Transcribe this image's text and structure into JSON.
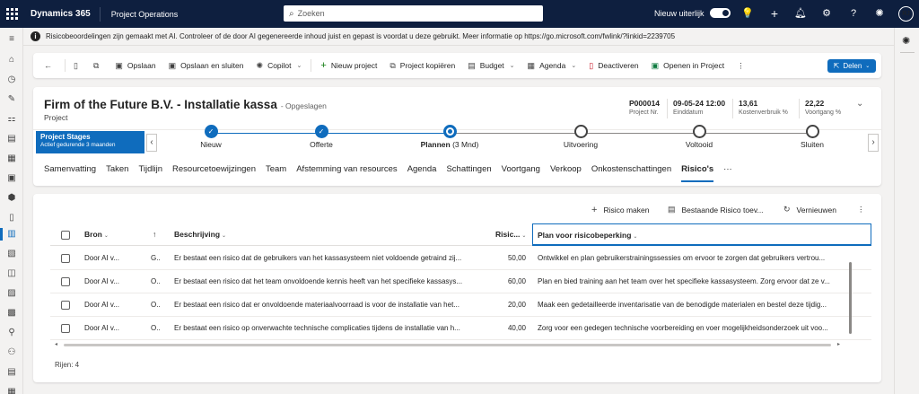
{
  "topbar": {
    "brand": "Dynamics 365",
    "app": "Project Operations",
    "search_placeholder": "Zoeken",
    "new_look": "Nieuw uiterlijk",
    "avatar_initials": "RJ"
  },
  "banner": {
    "text": "Risicobeoordelingen zijn gemaakt met AI. Controleer of de door AI gegenereerde inhoud juist en gepast is voordat u deze gebruikt. Meer informatie op https://go.microsoft.com/fwlink/?linkid=2239705"
  },
  "commandbar": {
    "save": "Opslaan",
    "save_close": "Opslaan en sluiten",
    "copilot": "Copilot",
    "new_project": "Nieuw project",
    "copy_project": "Project kopiëren",
    "budget": "Budget",
    "agenda": "Agenda",
    "deactivate": "Deactiveren",
    "open_in_project": "Openen in Project",
    "share": "Delen"
  },
  "record": {
    "title": "Firm of the Future B.V. - Installatie kassa",
    "status": "- Opgeslagen",
    "type": "Project",
    "fields": [
      {
        "value": "P000014",
        "label": "Project Nr."
      },
      {
        "value": "09-05-24 12:00",
        "label": "Einddatum"
      },
      {
        "value": "13,61",
        "label": "Kostenverbruik %"
      },
      {
        "value": "22,22",
        "label": "Voortgang %"
      }
    ]
  },
  "bpf": {
    "flag_title": "Project Stages",
    "flag_subtitle": "Actief gedurende 3 maanden",
    "stages": [
      {
        "label": "Nieuw",
        "state": "done"
      },
      {
        "label": "Offerte",
        "state": "done"
      },
      {
        "label": "Plannen",
        "suffix": "(3 Mnd)",
        "state": "active"
      },
      {
        "label": "Uitvoering",
        "state": "todo"
      },
      {
        "label": "Voltooid",
        "state": "todo"
      },
      {
        "label": "Sluiten",
        "state": "todo"
      }
    ]
  },
  "tabs": [
    "Samenvatting",
    "Taken",
    "Tijdlijn",
    "Resourcetoewijzingen",
    "Team",
    "Afstemming van resources",
    "Agenda",
    "Schattingen",
    "Voortgang",
    "Verkoop",
    "Onkostenschattingen",
    "Risico's"
  ],
  "tabs_more": "···",
  "grid": {
    "commands": {
      "new_risk": "Risico maken",
      "existing_risk": "Bestaande Risico toev...",
      "refresh": "Vernieuwen"
    },
    "columns": {
      "bron": "Bron",
      "beschrijving": "Beschrijving",
      "risico": "Risic...",
      "plan": "Plan voor risicobeperking"
    },
    "rows": [
      {
        "bron": "Door AI v...",
        "flag": "G..",
        "beschrijving": "Er bestaat een risico dat de gebruikers van het kassasysteem niet voldoende getraind zij...",
        "risico": "50,00",
        "plan": "Ontwikkel en plan gebruikerstrainingssessies om ervoor te zorgen dat gebruikers vertrou..."
      },
      {
        "bron": "Door AI v...",
        "flag": "O..",
        "beschrijving": "Er bestaat een risico dat het team onvoldoende kennis heeft van het specifieke kassasys...",
        "risico": "60,00",
        "plan": "Plan en bied training aan het team over het specifieke kassasysteem. Zorg ervoor dat ze v..."
      },
      {
        "bron": "Door AI v...",
        "flag": "O..",
        "beschrijving": "Er bestaat een risico dat er onvoldoende materiaalvoorraad is voor de installatie van het...",
        "risico": "20,00",
        "plan": "Maak een gedetailleerde inventarisatie van de benodigde materialen en bestel deze tijdig..."
      },
      {
        "bron": "Door AI v...",
        "flag": "O..",
        "beschrijving": "Er bestaat een risico op onverwachte technische complicaties tijdens de installatie van h...",
        "risico": "40,00",
        "plan": "Zorg voor een gedegen technische voorbereiding en voer mogelijkheidsonderzoek uit voo..."
      }
    ],
    "footer": "Rijen: 4"
  },
  "colors": {
    "accent": "#0f6cbd",
    "nav": "#0e1f3f"
  }
}
